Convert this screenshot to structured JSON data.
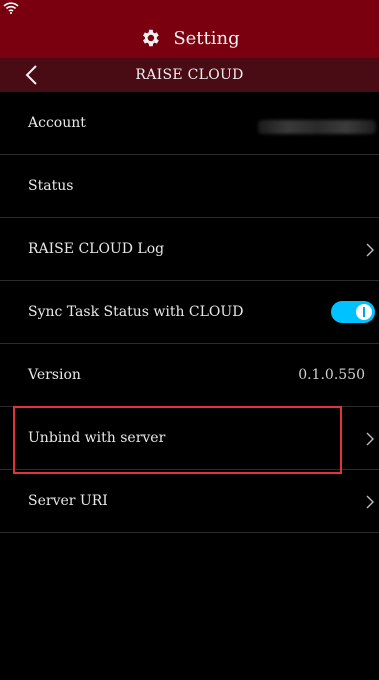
{
  "header": {
    "title": "Setting",
    "icon": "gear-icon"
  },
  "subheader": {
    "title": "RAISE CLOUD",
    "back_icon": "chevron-left-icon"
  },
  "rows": [
    {
      "label": "Account",
      "value": ""
    },
    {
      "label": "Status",
      "value": ""
    },
    {
      "label": "RAISE CLOUD Log",
      "value": ""
    },
    {
      "label": "Sync Task Status with CLOUD",
      "toggle_on": true
    },
    {
      "label": "Version",
      "value": "0.1.0.550"
    },
    {
      "label": "Unbind with server",
      "value": ""
    },
    {
      "label": "Server URI",
      "value": ""
    }
  ],
  "colors": {
    "header": "#7a0010",
    "subheader": "#4a0c14",
    "toggle": "#00c2ff",
    "highlight": "#e2333b"
  }
}
